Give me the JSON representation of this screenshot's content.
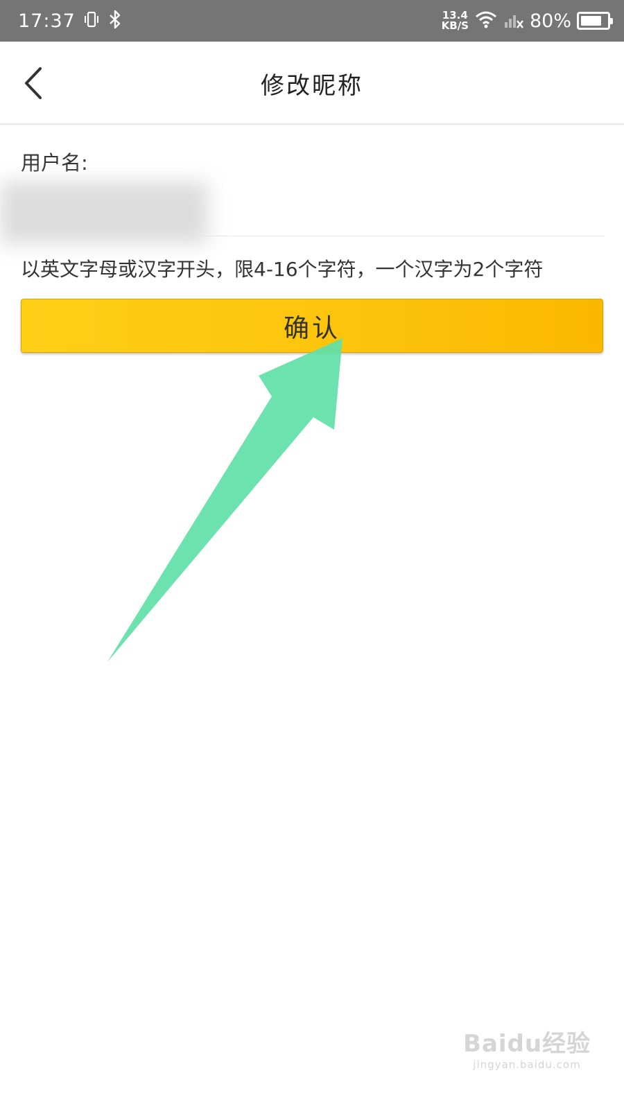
{
  "status_bar": {
    "time": "17:37",
    "net_speed_value": "13.4",
    "net_speed_unit": "KB/S",
    "battery_percent": "80%",
    "battery_level": 0.8
  },
  "header": {
    "title": "修改昵称"
  },
  "form": {
    "username_label": "用户名:",
    "username_value": "",
    "hint": "以英文字母或汉字开头，限4-16个字符，一个汉字为2个字符",
    "confirm_label": "确认"
  },
  "watermark": {
    "brand": "Baidu经验",
    "url": "jingyan.baidu.com"
  },
  "colors": {
    "status_bar": "#757575",
    "confirm_button": "#fdc30b",
    "annotation_arrow": "#5fe0a8"
  }
}
